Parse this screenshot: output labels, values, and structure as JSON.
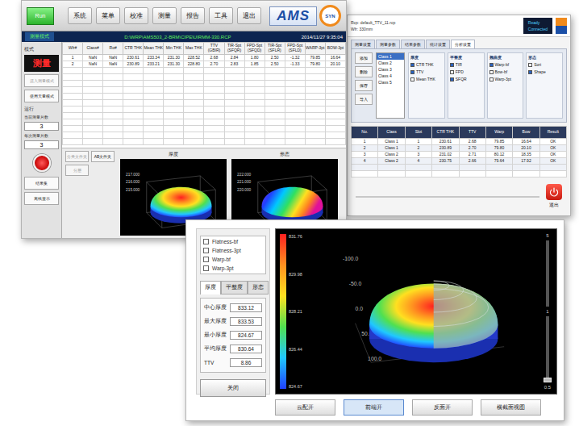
{
  "main_window": {
    "run_button": "Run",
    "menu": [
      "系统",
      "菜单",
      "校准",
      "测量",
      "报告",
      "工具",
      "退出"
    ],
    "logo": {
      "text": "AMS",
      "badge": "SYN"
    },
    "mode_bar": {
      "mode": "测量模式",
      "path": "D:\\WRP\\AMS503_2-BRM\\CIPE\\UIRMM-330.RCP",
      "time": "2014/11/27 9:35:04"
    },
    "sidebar": {
      "mode_label": "模式",
      "mode_value": "测量",
      "mode_buttons": [
        {
          "label": "进入测量模式",
          "disabled": true
        },
        {
          "label": "使用天量模式",
          "disabled": false
        }
      ],
      "run_label": "运行",
      "fields": [
        {
          "label": "当前测量片数",
          "value": "3"
        },
        {
          "label": "每次测量片数",
          "value": "3"
        }
      ],
      "actions": [
        "结果集",
        "离线显示"
      ]
    },
    "table": {
      "columns": [
        "Wfr#",
        "Class#",
        "Ro#",
        "CTR THK",
        "Mean THK",
        "Min THK",
        "Max THK",
        "TTV (GBIR)",
        "TIR-Spt (SFQR)",
        "FPD-Spt (SFQD)",
        "TIR-Spt (SFLR)",
        "FPD-Spt (SFLD)",
        "WARP-3pt",
        "BOW-3pt"
      ],
      "rows": [
        [
          "1",
          "NaN",
          "NaN",
          "230.61",
          "233.34",
          "231.30",
          "228.52",
          "2.68",
          "2.84",
          "1.80",
          "2.50",
          "-1.32",
          "79.85",
          "16.64"
        ],
        [
          "2",
          "NaN",
          "NaN",
          "230.89",
          "233.21",
          "231.30",
          "228.80",
          "2.70",
          "2.83",
          "1.85",
          "2.50",
          "-1.33",
          "79.80",
          "20.10"
        ]
      ]
    },
    "table_buttons": [
      {
        "label": "分类文件夹",
        "disabled": true
      },
      {
        "label": "AB文件夹",
        "disabled": false
      },
      {
        "label": "分层",
        "disabled": true
      }
    ],
    "plots": [
      {
        "title": "厚度",
        "kind": "thickness",
        "ticks": [
          "217.000",
          "216.000",
          "215.000"
        ]
      },
      {
        "title": "形态",
        "kind": "shape",
        "ticks": [
          "222.000",
          "221.000",
          "220.000"
        ]
      }
    ]
  },
  "settings_window": {
    "info": [
      "Rcp: default_TTV_11.rcp",
      "Wfr: 330mm"
    ],
    "status": [
      "Ready",
      "Connected"
    ],
    "tabs": [
      {
        "label": "测量设置",
        "selected": false
      },
      {
        "label": "测量参数",
        "selected": false
      },
      {
        "label": "结果参数",
        "selected": false
      },
      {
        "label": "统计设置",
        "selected": false
      },
      {
        "label": "分析设置",
        "selected": true
      }
    ],
    "side_buttons": [
      "添加",
      "删除",
      "保存",
      "导入"
    ],
    "class_list": [
      {
        "label": "Class 1",
        "selected": true
      },
      {
        "label": "Class 2",
        "selected": false
      },
      {
        "label": "Class 3",
        "selected": false
      },
      {
        "label": "Class 4",
        "selected": false
      },
      {
        "label": "Class 5",
        "selected": false
      }
    ],
    "groups": [
      {
        "title": "厚度",
        "items": [
          {
            "label": "CTR THK",
            "checked": true
          },
          {
            "label": "TTV",
            "checked": true
          },
          {
            "label": "Mean THK",
            "checked": false
          }
        ]
      },
      {
        "title": "平整度",
        "items": [
          {
            "label": "TIR",
            "checked": true
          },
          {
            "label": "FPD",
            "checked": false
          },
          {
            "label": "SFQR",
            "checked": true
          }
        ]
      },
      {
        "title": "翘曲度",
        "items": [
          {
            "label": "Warp-bf",
            "checked": true
          },
          {
            "label": "Bow-bf",
            "checked": false
          },
          {
            "label": "Warp-3pt",
            "checked": false
          }
        ]
      },
      {
        "title": "形态",
        "items": [
          {
            "label": "Sori",
            "checked": false
          },
          {
            "label": "Shape",
            "checked": true
          }
        ]
      }
    ],
    "table": {
      "columns": [
        "No.",
        "Class",
        "Slot",
        "CTR THK",
        "TTV",
        "Warp",
        "Bow",
        "Result"
      ],
      "rows": [
        [
          "1",
          "Class 1",
          "1",
          "230.61",
          "2.68",
          "79.85",
          "16.64",
          "OK"
        ],
        [
          "2",
          "Class 1",
          "2",
          "230.89",
          "2.70",
          "79.80",
          "20.10",
          "OK"
        ],
        [
          "3",
          "Class 2",
          "3",
          "231.02",
          "2.71",
          "80.12",
          "18.35",
          "OK"
        ],
        [
          "4",
          "Class 2",
          "4",
          "230.75",
          "2.66",
          "79.64",
          "17.92",
          "OK"
        ]
      ]
    },
    "exit_button": "退出"
  },
  "viewer_window": {
    "checks": [
      {
        "label": "Flatness-bf",
        "checked": false
      },
      {
        "label": "Flatness-3pt",
        "checked": false
      },
      {
        "label": "Warp-bf",
        "checked": false
      },
      {
        "label": "Warp-3pt",
        "checked": false
      }
    ],
    "tabs": [
      {
        "label": "厚度",
        "selected": true
      },
      {
        "label": "平整度",
        "selected": false
      },
      {
        "label": "形态",
        "selected": false
      }
    ],
    "stats": [
      {
        "label": "中心厚度",
        "value": "833.12"
      },
      {
        "label": "最大厚度",
        "value": "833.53"
      },
      {
        "label": "最小厚度",
        "value": "824.67"
      },
      {
        "label": "平均厚度",
        "value": "830.64"
      },
      {
        "label": "TTV",
        "value": "8.86"
      }
    ],
    "close_button": "关闭",
    "colorbar": [
      "831.76",
      "829.98",
      "828.21",
      "826.44",
      "824.67"
    ],
    "axis_ticks": [
      "-100.0",
      "-50.0",
      "0.0",
      "50.0",
      "100.0"
    ],
    "scale": [
      "5",
      "1",
      "0.5"
    ],
    "buttons": [
      {
        "label": "云配开",
        "selected": false
      },
      {
        "label": "前端开",
        "selected": true
      },
      {
        "label": "反面开",
        "selected": false
      },
      {
        "label": "横截面视图",
        "selected": false
      }
    ]
  }
}
